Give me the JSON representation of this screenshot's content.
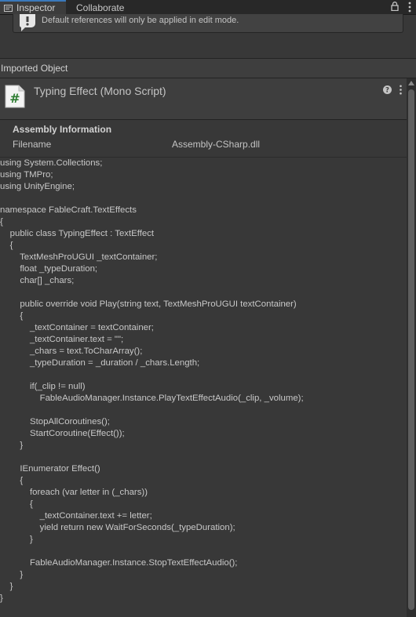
{
  "tabs": {
    "inspector": "Inspector",
    "collaborate": "Collaborate"
  },
  "helpbox": {
    "text": "Default references will only be applied in edit mode."
  },
  "section": {
    "imported_object": "Imported Object"
  },
  "object": {
    "title": "Typing Effect (Mono Script)",
    "icon_glyph": "#"
  },
  "assembly": {
    "title": "Assembly Information",
    "filename_label": "Filename",
    "filename_value": "Assembly-CSharp.dll"
  },
  "code": [
    "using System.Collections;",
    "using TMPro;",
    "using UnityEngine;",
    "",
    "namespace FableCraft.TextEffects",
    "{",
    "    public class TypingEffect : TextEffect",
    "    {",
    "        TextMeshProUGUI _textContainer;",
    "        float _typeDuration;",
    "        char[] _chars;",
    "",
    "        public override void Play(string text, TextMeshProUGUI textContainer)",
    "        {",
    "            _textContainer = textContainer;",
    "            _textContainer.text = \"\";",
    "            _chars = text.ToCharArray();",
    "            _typeDuration = _duration / _chars.Length;",
    "",
    "            if(_clip != null)",
    "                FableAudioManager.Instance.PlayTextEffectAudio(_clip, _volume);",
    "",
    "            StopAllCoroutines();",
    "            StartCoroutine(Effect());",
    "        }",
    "",
    "        IEnumerator Effect()",
    "        {",
    "            foreach (var letter in (_chars))",
    "            {",
    "                _textContainer.text += letter;",
    "                yield return new WaitForSeconds(_typeDuration);",
    "            }",
    "",
    "            FableAudioManager.Instance.StopTextEffectAudio();",
    "        }",
    "    }",
    "}"
  ],
  "colors": {
    "background": "#383838",
    "tab_accent": "#3a79bb",
    "script_icon_bg": "#f4f4f4",
    "script_icon_fg": "#2e7d32"
  }
}
